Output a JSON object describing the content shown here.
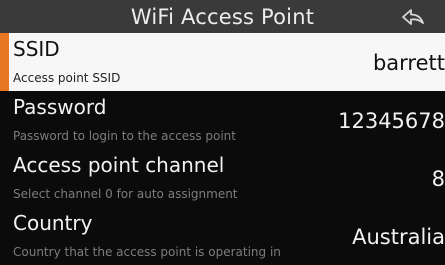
{
  "header": {
    "title": "WiFi Access Point",
    "back_icon": "back-arrow-icon"
  },
  "colors": {
    "accent": "#e87722",
    "selected_background": "#f7f7f7",
    "header_background": "#3a3a3a",
    "background": "#0b0b0b"
  },
  "settings": [
    {
      "label": "SSID",
      "description": "Access point SSID",
      "value": "barrett",
      "selected": true
    },
    {
      "label": "Password",
      "description": "Password to login to the access point",
      "value": "12345678",
      "selected": false
    },
    {
      "label": "Access point channel",
      "description": "Select channel 0 for auto assignment",
      "value": "8",
      "selected": false
    },
    {
      "label": "Country",
      "description": "Country that the access point is operating in",
      "value": "Australia",
      "selected": false
    }
  ]
}
